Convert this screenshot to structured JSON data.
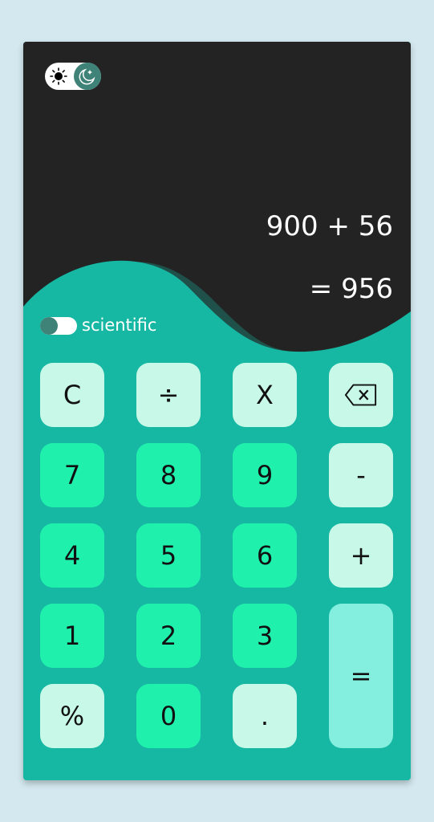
{
  "theme_toggle": {
    "sun_icon": "sun-icon",
    "moon_icon": "moon-icon",
    "mode": "dark"
  },
  "display": {
    "expression": "900 + 56",
    "result": "= 956"
  },
  "scientific": {
    "label": "scientific",
    "enabled": false
  },
  "keys": {
    "clear": "C",
    "divide": "÷",
    "multiply": "X",
    "backspace_icon": "backspace-icon",
    "seven": "7",
    "eight": "8",
    "nine": "9",
    "minus": "-",
    "four": "4",
    "five": "5",
    "six": "6",
    "plus": "+",
    "one": "1",
    "two": "2",
    "three": "3",
    "equals": "=",
    "percent": "%",
    "zero": "0",
    "dot": "."
  },
  "colors": {
    "page_bg": "#d3e9ef",
    "display_bg": "#232323",
    "keypad_bg": "#16b8a4",
    "key_light": "#c8f9e8",
    "key_green": "#1ff1ac",
    "key_equals": "#84efdf",
    "accent": "#3f8378"
  }
}
